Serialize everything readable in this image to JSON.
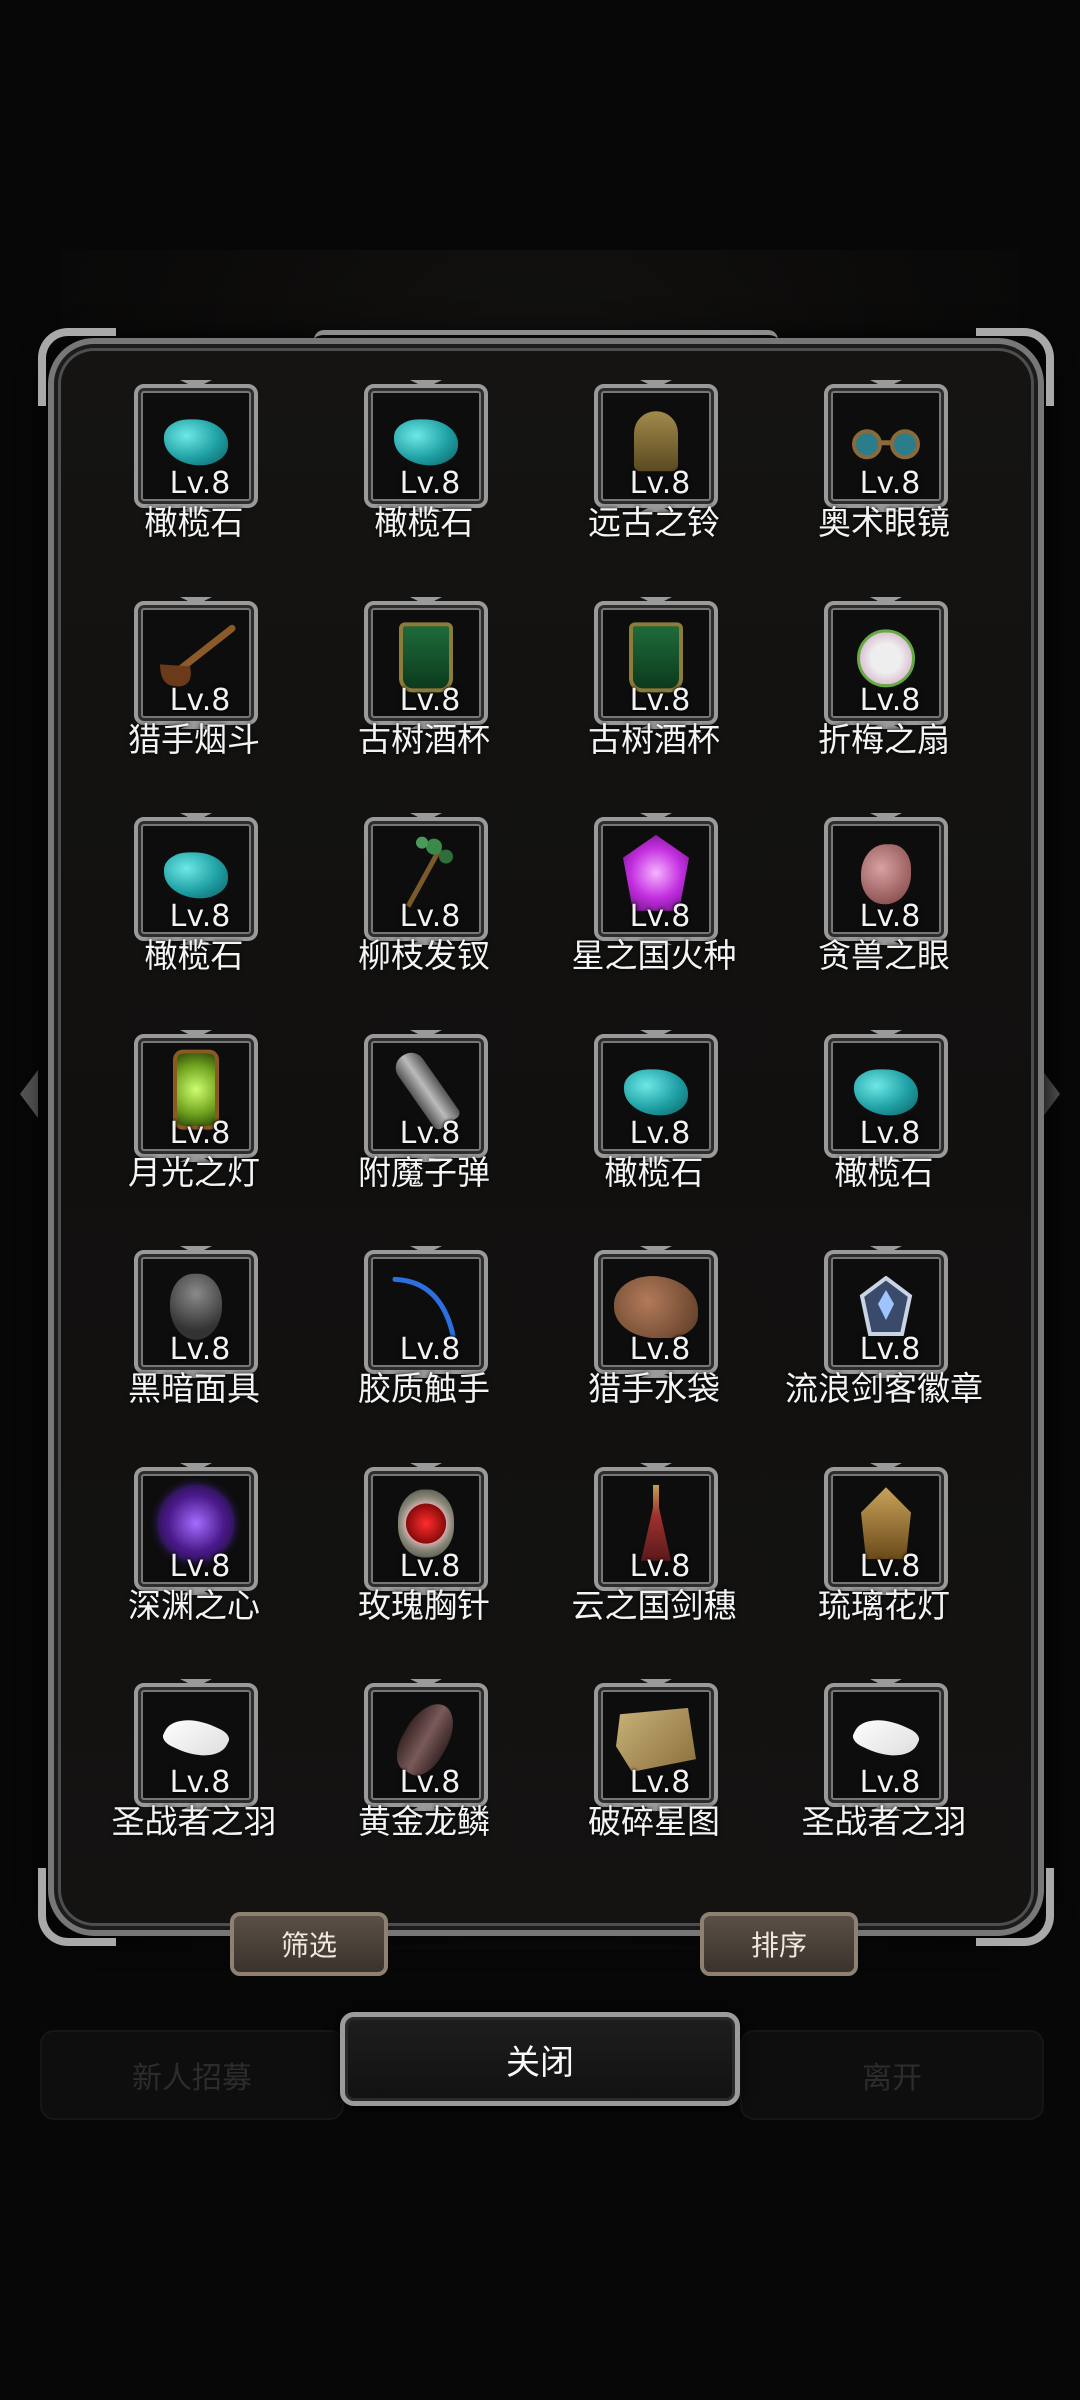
{
  "background": {
    "hint_left": "新人招募",
    "hint_right": "离开"
  },
  "items": [
    {
      "name": "橄榄石",
      "level": "Lv.8",
      "icon": "olivine-stone-icon"
    },
    {
      "name": "橄榄石",
      "level": "Lv.8",
      "icon": "olivine-stone-icon"
    },
    {
      "name": "远古之铃",
      "level": "Lv.8",
      "icon": "ancient-bell-icon"
    },
    {
      "name": "奥术眼镜",
      "level": "Lv.8",
      "icon": "arcane-goggles-icon"
    },
    {
      "name": "猎手烟斗",
      "level": "Lv.8",
      "icon": "hunter-pipe-icon"
    },
    {
      "name": "古树酒杯",
      "level": "Lv.8",
      "icon": "ancient-tree-cup-icon"
    },
    {
      "name": "古树酒杯",
      "level": "Lv.8",
      "icon": "ancient-tree-cup-icon"
    },
    {
      "name": "折梅之扇",
      "level": "Lv.8",
      "icon": "plum-fan-icon"
    },
    {
      "name": "橄榄石",
      "level": "Lv.8",
      "icon": "olivine-stone-icon"
    },
    {
      "name": "柳枝发钗",
      "level": "Lv.8",
      "icon": "willow-hairpin-icon"
    },
    {
      "name": "星之国火种",
      "level": "Lv.8",
      "icon": "star-kingdom-tinder-icon"
    },
    {
      "name": "贪兽之眼",
      "level": "Lv.8",
      "icon": "greedy-beast-eye-icon"
    },
    {
      "name": "月光之灯",
      "level": "Lv.8",
      "icon": "moonlight-lantern-icon"
    },
    {
      "name": "附魔子弹",
      "level": "Lv.8",
      "icon": "enchanted-bullet-icon"
    },
    {
      "name": "橄榄石",
      "level": "Lv.8",
      "icon": "olivine-stone-icon"
    },
    {
      "name": "橄榄石",
      "level": "Lv.8",
      "icon": "olivine-stone-icon"
    },
    {
      "name": "黑暗面具",
      "level": "Lv.8",
      "icon": "dark-mask-icon"
    },
    {
      "name": "胶质触手",
      "level": "Lv.8",
      "icon": "gel-tentacle-icon"
    },
    {
      "name": "猎手水袋",
      "level": "Lv.8",
      "icon": "hunter-waterskin-icon"
    },
    {
      "name": "流浪剑客徽章",
      "level": "Lv.8",
      "icon": "swordsman-badge-icon"
    },
    {
      "name": "深渊之心",
      "level": "Lv.8",
      "icon": "abyss-heart-icon"
    },
    {
      "name": "玫瑰胸针",
      "level": "Lv.8",
      "icon": "rose-brooch-icon"
    },
    {
      "name": "云之国剑穗",
      "level": "Lv.8",
      "icon": "cloud-kingdom-tassel-icon"
    },
    {
      "name": "琉璃花灯",
      "level": "Lv.8",
      "icon": "glaze-flower-lamp-icon"
    },
    {
      "name": "圣战者之羽",
      "level": "Lv.8",
      "icon": "crusader-feather-icon"
    },
    {
      "name": "黄金龙鳞",
      "level": "Lv.8",
      "icon": "golden-dragon-scale-icon"
    },
    {
      "name": "破碎星图",
      "level": "Lv.8",
      "icon": "broken-star-map-icon"
    },
    {
      "name": "圣战者之羽",
      "level": "Lv.8",
      "icon": "crusader-feather-icon"
    }
  ],
  "buttons": {
    "filter": "筛选",
    "sort": "排序",
    "close": "关闭"
  }
}
